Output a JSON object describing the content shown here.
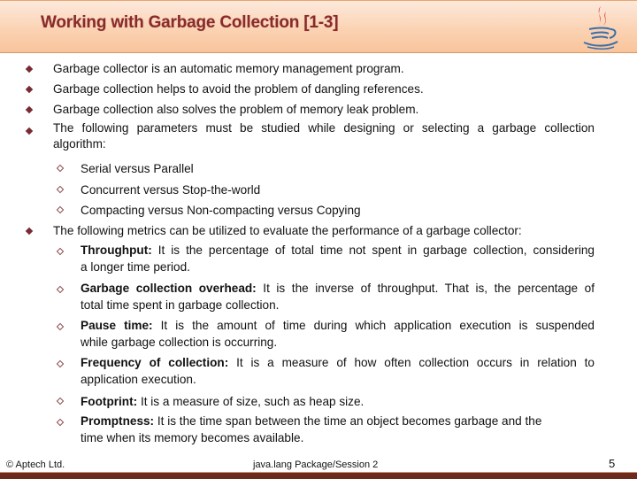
{
  "header": {
    "title": "Working with Garbage Collection [1-3]",
    "logo": "java-coffee-cup-icon"
  },
  "bullets": [
    {
      "text": "Garbage collector is an automatic memory management program."
    },
    {
      "text": "Garbage collection helps to avoid the problem of dangling references."
    },
    {
      "text": "Garbage collection also solves the problem of memory leak problem."
    },
    {
      "line1": "The following parameters must be studied while designing or selecting a garbage collection",
      "line2": "algorithm:",
      "subitems": [
        {
          "text": "Serial versus Parallel"
        },
        {
          "text": "Concurrent versus Stop-the-world"
        },
        {
          "text": "Compacting versus Non-compacting versus Copying"
        }
      ]
    },
    {
      "text": "The following metrics can be utilized to evaluate the performance of a garbage collector:",
      "subitems": [
        {
          "term": "Throughput:",
          "line1": " It is the percentage of total time not spent in garbage collection, considering",
          "line2": "a longer time period."
        },
        {
          "term": "Garbage collection overhead:",
          "line1": " It is the inverse of throughput. That is, the percentage of",
          "line2": "total time spent in garbage collection."
        },
        {
          "term": "Pause time:",
          "line1": " It is the amount of time during which application execution is suspended",
          "line2": "while garbage collection is occurring."
        },
        {
          "term": "Frequency of collection:",
          "line1": " It is a measure of how often collection occurs in relation to",
          "line2": "application execution."
        },
        {
          "term": "Footprint:",
          "line1": " It is a measure of size, such as heap size."
        },
        {
          "term": "Promptness:",
          "line1": " It is the time span between the time an object becomes garbage and the",
          "line2": "time when its memory becomes available."
        }
      ]
    }
  ],
  "footer": {
    "copyright": "© Aptech Ltd.",
    "center": "java.lang Package/Session 2",
    "page_number": "5"
  },
  "colors": {
    "title": "#8a2b2b",
    "header_bg": "#fbd3b3",
    "bullet": "#7a2a34",
    "footer_bar": "#6b2a1e"
  }
}
